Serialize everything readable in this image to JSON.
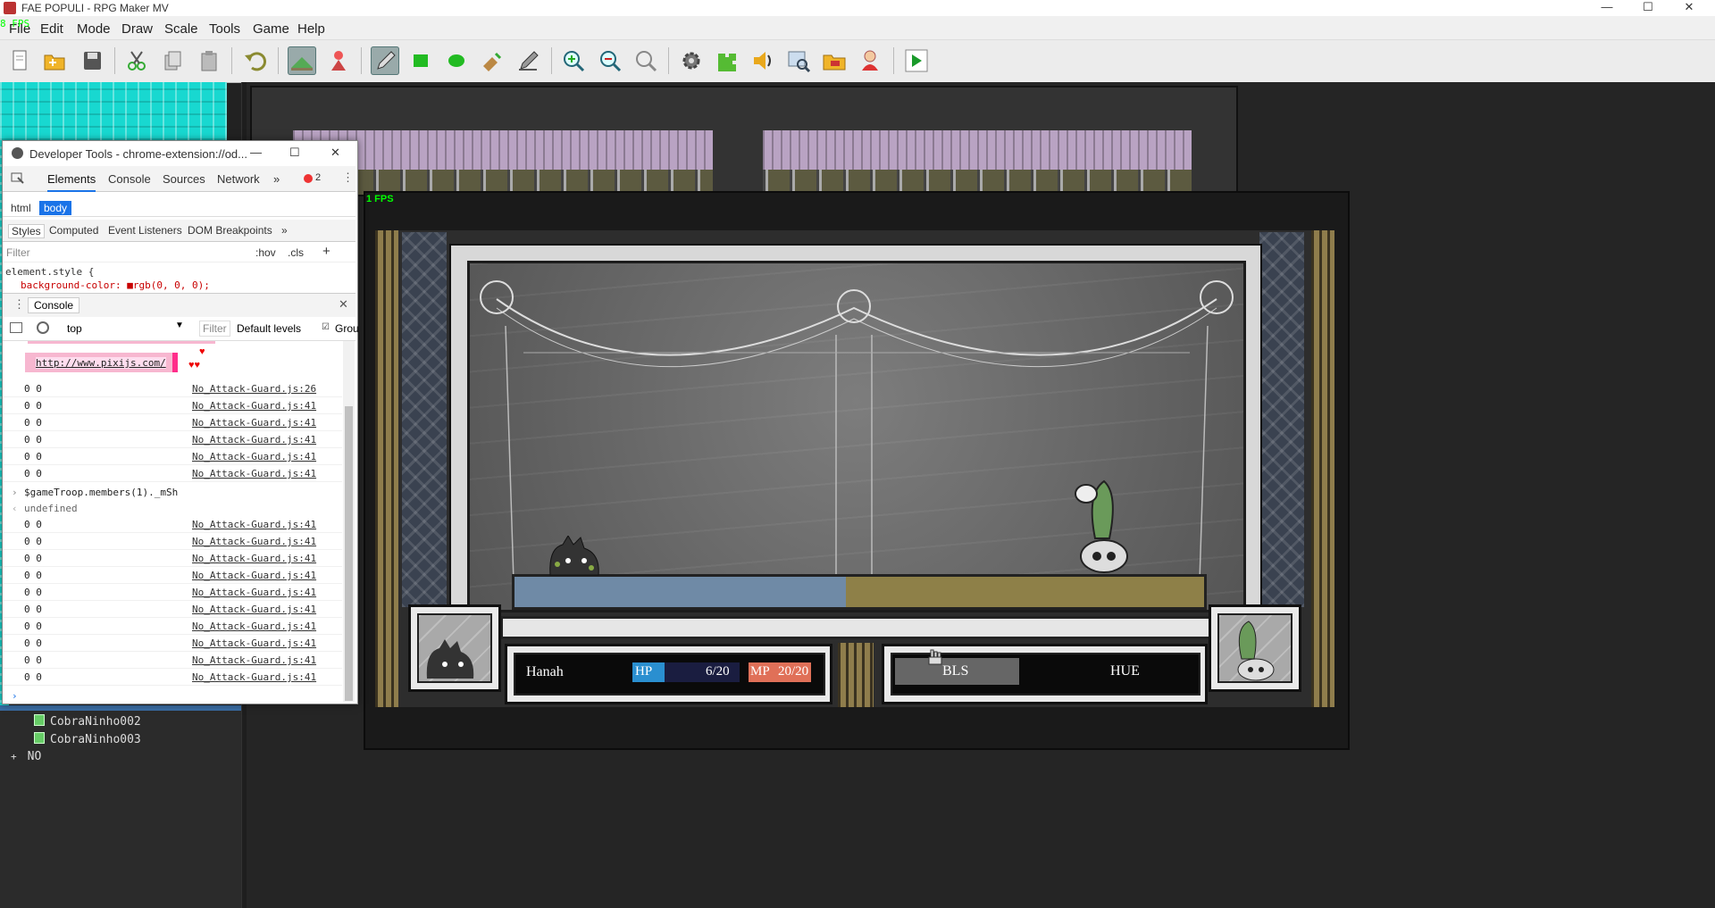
{
  "window": {
    "title": "FAE POPULI - RPG Maker MV",
    "fps_badge": "8 FPS",
    "controls": [
      "—",
      "☐",
      "✕"
    ]
  },
  "menubar": [
    "File",
    "Edit",
    "Mode",
    "Draw",
    "Scale",
    "Tools",
    "Game",
    "Help"
  ],
  "toolbar": {
    "icons": [
      "new-project-icon",
      "open-project-icon",
      "save-project-icon",
      "cut-icon",
      "copy-icon",
      "paste-icon",
      "undo-icon",
      "map-mode-icon",
      "event-mode-icon",
      "pencil-icon",
      "rectangle-icon",
      "ellipse-icon",
      "fill-icon",
      "shadow-pen-icon",
      "zoom-in-icon",
      "zoom-out-icon",
      "actual-size-icon",
      "database-icon",
      "plugin-manager-icon",
      "sound-test-icon",
      "event-searcher-icon",
      "resource-manager-icon",
      "character-generator-icon",
      "playtest-icon"
    ]
  },
  "map_tree": {
    "items": [
      {
        "label": "CobraNinho002"
      },
      {
        "label": "CobraNinho003"
      },
      {
        "label": "NO"
      }
    ],
    "expand_glyph": "+"
  },
  "devtools": {
    "title": "Developer Tools - chrome-extension://od...",
    "tabs": [
      "Elements",
      "Console",
      "Sources",
      "Network"
    ],
    "more": "»",
    "error_count": "2",
    "breadcrumbs": [
      "html",
      "body"
    ],
    "subtabs": [
      "Styles",
      "Computed",
      "Event Listeners",
      "DOM Breakpoints"
    ],
    "filter_placeholder": "Filter",
    "hov": ":hov",
    "cls": ".cls",
    "plus": "+",
    "style_line1": "element.style {",
    "style_line2": "background-color: ■rgb(0, 0, 0);"
  },
  "console": {
    "title": "Console",
    "context": "top",
    "filter_placeholder": "Filter",
    "levels": "Default levels",
    "group": "Grou",
    "pixi_link": "http://www.pixijs.com/",
    "logs_a": [
      {
        "value": "0 0",
        "source": "No_Attack-Guard.js:26"
      },
      {
        "value": "0 0",
        "source": "No_Attack-Guard.js:41"
      },
      {
        "value": "0 0",
        "source": "No_Attack-Guard.js:41"
      },
      {
        "value": "0 0",
        "source": "No_Attack-Guard.js:41"
      },
      {
        "value": "0 0",
        "source": "No_Attack-Guard.js:41"
      },
      {
        "value": "0 0",
        "source": "No_Attack-Guard.js:41"
      }
    ],
    "input_cmd": "$gameTroop.members(1)._mSh",
    "result": "undefined",
    "logs_b": [
      {
        "value": "0 0",
        "source": "No_Attack-Guard.js:41"
      },
      {
        "value": "0 0",
        "source": "No_Attack-Guard.js:41"
      },
      {
        "value": "0 0",
        "source": "No_Attack-Guard.js:41"
      },
      {
        "value": "0 0",
        "source": "No_Attack-Guard.js:41"
      },
      {
        "value": "0 0",
        "source": "No_Attack-Guard.js:41"
      },
      {
        "value": "0 0",
        "source": "No_Attack-Guard.js:41"
      },
      {
        "value": "0 0",
        "source": "No_Attack-Guard.js:41"
      },
      {
        "value": "0 0",
        "source": "No_Attack-Guard.js:41"
      },
      {
        "value": "0 0",
        "source": "No_Attack-Guard.js:41"
      },
      {
        "value": "0 0",
        "source": "No_Attack-Guard.js:41"
      }
    ]
  },
  "game": {
    "fps": "1 FPS",
    "hero_name": "Hanah",
    "hp_label": "HP",
    "hp_value": "6/20",
    "hp_ratio": 0.3,
    "mp_label": "MP",
    "mp_value": "20/20",
    "mp_ratio": 1.0,
    "commands": [
      "BLS",
      "HUE"
    ],
    "colors": {
      "hp": "#2a8fd0",
      "mp": "#e07058"
    }
  }
}
